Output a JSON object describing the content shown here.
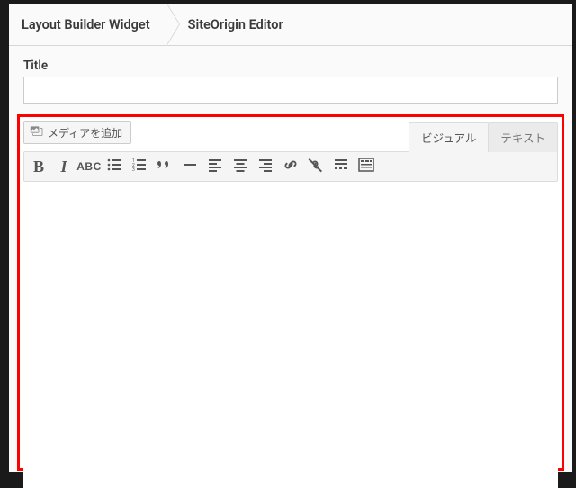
{
  "breadcrumb": {
    "item1": "Layout Builder Widget",
    "item2": "SiteOrigin Editor"
  },
  "form": {
    "title_label": "Title",
    "title_value": ""
  },
  "editor": {
    "add_media_label": "メディアを追加",
    "tab_visual": "ビジュアル",
    "tab_text": "テキスト",
    "content": "",
    "toolbar": {
      "bold_glyph": "B",
      "italic_glyph": "I",
      "strike_glyph": "ABC"
    }
  }
}
